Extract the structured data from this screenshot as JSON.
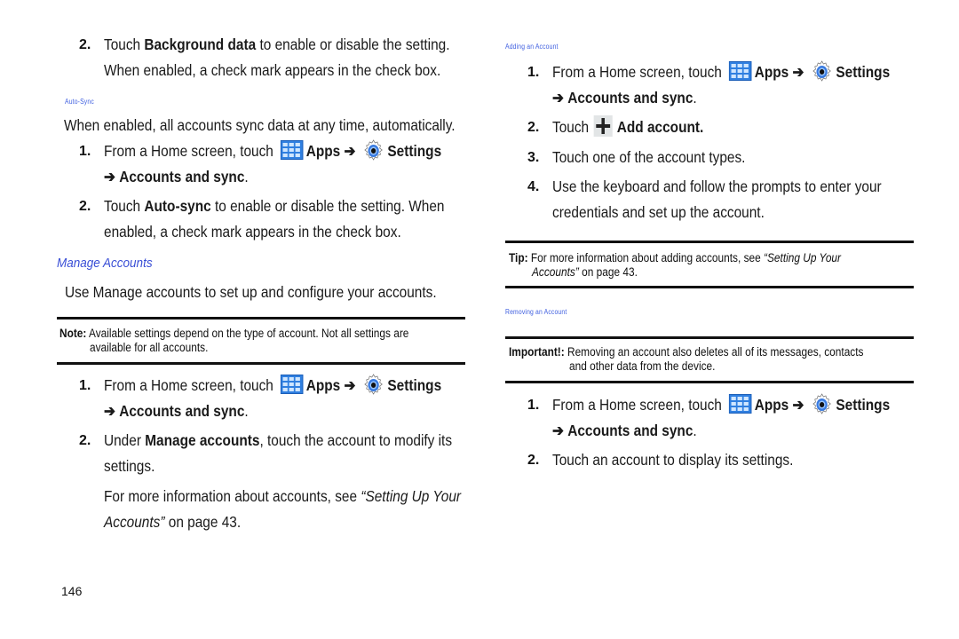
{
  "page_number": "146",
  "shared": {
    "from_home": "From a Home screen, touch",
    "apps": "Apps",
    "arrow": "➔",
    "settings": "Settings",
    "accounts_and_sync": "Accounts and sync",
    "period": "."
  },
  "left": {
    "bg_step2": {
      "num": "2.",
      "pre": "Touch ",
      "bold": "Background data",
      "post": " to enable or disable the setting.",
      "line2": "When enabled, a check mark appears in the check box."
    },
    "autosync_heading": "Auto-Sync",
    "autosync_intro": "When enabled, all accounts sync data at any time, automatically.",
    "autosync_step1_num": "1.",
    "autosync_step2": {
      "num": "2.",
      "pre": "Touch ",
      "bold": "Auto-sync",
      "post": " to enable or disable the setting. When",
      "line2": "enabled, a check mark appears in the check box."
    },
    "manage_heading": "Manage Accounts",
    "manage_intro": "Use Manage accounts to set up and configure your accounts.",
    "note": {
      "label": "Note:",
      "line1": " Available settings depend on the type of account. Not all settings are",
      "line2": "available for all accounts."
    },
    "manage_step1_num": "1.",
    "manage_step2": {
      "num": "2.",
      "pre": "Under ",
      "bold": "Manage accounts",
      "post": ", touch the account to modify its",
      "line2": "settings."
    },
    "more_info": {
      "pre": "For more information about accounts, see ",
      "ref1": "“Setting Up Your",
      "ref2": "Accounts”",
      "post": " on page 43."
    }
  },
  "right": {
    "adding_heading": "Adding an Account",
    "add_step1_num": "1.",
    "add_step2": {
      "num": "2.",
      "pre": "Touch",
      "bold": "Add account."
    },
    "add_step3": {
      "num": "3.",
      "text": "Touch one of the account types."
    },
    "add_step4": {
      "num": "4.",
      "line1": "Use the keyboard and follow the prompts to enter your",
      "line2": "credentials and set up the account."
    },
    "tip": {
      "label": "Tip:",
      "pre": " For more information about adding accounts, see ",
      "ref1": "“Setting Up Your",
      "ref2": "Accounts”",
      "post": " on page 43."
    },
    "removing_heading": "Removing an Account",
    "important": {
      "label": "Important!:",
      "line1": " Removing an account also deletes all of its messages, contacts",
      "line2": "and other data from the device."
    },
    "remove_step1_num": "1.",
    "remove_step2": {
      "num": "2.",
      "text": "Touch an account to display its settings."
    }
  },
  "colors": {
    "heading_blue": "#3a4fd6",
    "apps_icon_blue": "#2f7fe0"
  }
}
